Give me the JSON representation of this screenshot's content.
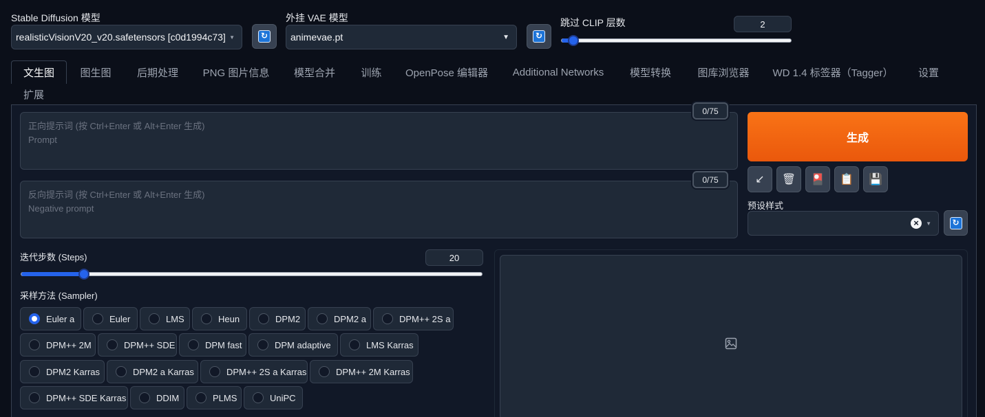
{
  "header": {
    "model_label": "Stable Diffusion 模型",
    "model_value": "realisticVisionV20_v20.safetensors [c0d1994c73]",
    "vae_label": "外挂 VAE 模型",
    "vae_value": "animevae.pt",
    "clip_label": "跳过 CLIP 层数",
    "clip_value": "2",
    "clip_slider_level": 0.05
  },
  "tabs": [
    {
      "label": "文生图",
      "active": true
    },
    {
      "label": "图生图"
    },
    {
      "label": "后期处理"
    },
    {
      "label": "PNG 图片信息"
    },
    {
      "label": "模型合并"
    },
    {
      "label": "训练"
    },
    {
      "label": "OpenPose 编辑器"
    },
    {
      "label": "Additional Networks"
    },
    {
      "label": "模型转换"
    },
    {
      "label": "图库浏览器"
    },
    {
      "label": "WD 1.4 标签器（Tagger）"
    },
    {
      "label": "设置"
    },
    {
      "label": "扩展"
    }
  ],
  "prompt": {
    "placeholder_line1": "正向提示词 (按 Ctrl+Enter 或 Alt+Enter 生成)",
    "placeholder_line2": "Prompt",
    "counter": "0/75"
  },
  "negative": {
    "placeholder_line1": "反向提示词 (按 Ctrl+Enter 或 Alt+Enter 生成)",
    "placeholder_line2": "Negative prompt",
    "counter": "0/75"
  },
  "generate_label": "生成",
  "tools": [
    {
      "icon": "arrow-icon",
      "glyph": "↙"
    },
    {
      "icon": "trash-icon",
      "glyph": "🗑"
    },
    {
      "icon": "style-card-icon",
      "glyph": "🎴"
    },
    {
      "icon": "clipboard-icon",
      "glyph": "📋"
    },
    {
      "icon": "save-icon",
      "glyph": "💾"
    }
  ],
  "styles": {
    "label": "预设样式",
    "clear_glyph": "×"
  },
  "steps": {
    "label": "迭代步数 (Steps)",
    "value": "20",
    "slider_level": 0.136
  },
  "sampler": {
    "label": "采样方法 (Sampler)",
    "rows": [
      [
        "Euler a",
        "Euler",
        "LMS",
        "Heun",
        "DPM2",
        "DPM2 a",
        "DPM++ 2S a"
      ],
      [
        "DPM++ 2M",
        "DPM++ SDE",
        "DPM fast",
        "DPM adaptive",
        "LMS Karras"
      ],
      [
        "DPM2 Karras",
        "DPM2 a Karras",
        "DPM++ 2S a Karras",
        "DPM++ 2M Karras"
      ],
      [
        "DPM++ SDE Karras",
        "DDIM",
        "PLMS",
        "UniPC"
      ]
    ],
    "selected": "Euler a"
  },
  "colors": {
    "background": "#0b0f19",
    "accent": "#2563eb",
    "generate": "#f97316"
  }
}
